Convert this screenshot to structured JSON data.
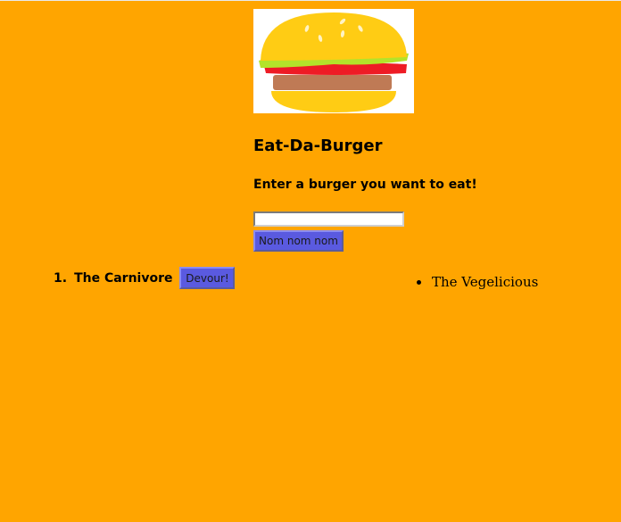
{
  "header": {
    "title": "Eat-Da-Burger",
    "subtitle": "Enter a burger you want to eat!"
  },
  "form": {
    "input_value": "",
    "submit_label": "Nom nom nom"
  },
  "to_eat": {
    "items": [
      {
        "number": "1.",
        "name": "The Carnivore",
        "button_label": "Devour!"
      }
    ]
  },
  "devoured": {
    "items": [
      {
        "name": "The Vegelicious"
      }
    ]
  },
  "colors": {
    "background": "#ffa500",
    "button": "#5a5ae0"
  }
}
